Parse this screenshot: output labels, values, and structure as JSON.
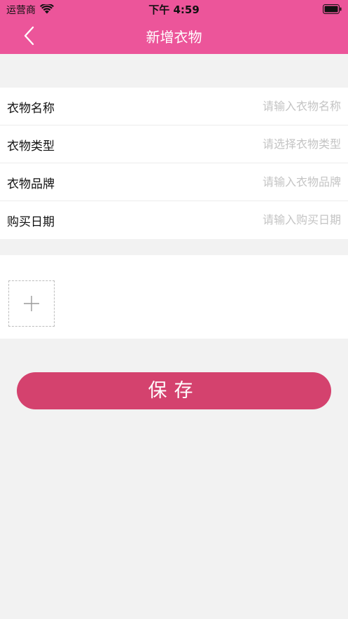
{
  "status_bar": {
    "carrier": "运营商",
    "time": "下午 4:59"
  },
  "nav": {
    "title": "新增衣物",
    "back_icon": "chevron-left-icon"
  },
  "form": {
    "rows": [
      {
        "label": "衣物名称",
        "placeholder": "请输入衣物名称",
        "value": ""
      },
      {
        "label": "衣物类型",
        "placeholder": "请选择衣物类型",
        "value": ""
      },
      {
        "label": "衣物品牌",
        "placeholder": "请输入衣物品牌",
        "value": ""
      },
      {
        "label": "购买日期",
        "placeholder": "请输入购买日期",
        "value": ""
      }
    ]
  },
  "photo": {
    "add_icon": "plus-icon"
  },
  "actions": {
    "save_label": "保存"
  },
  "colors": {
    "header_bg": "#ec559a",
    "save_bg": "#d4426e",
    "page_bg": "#f2f2f2",
    "placeholder": "#c4c4c4"
  }
}
